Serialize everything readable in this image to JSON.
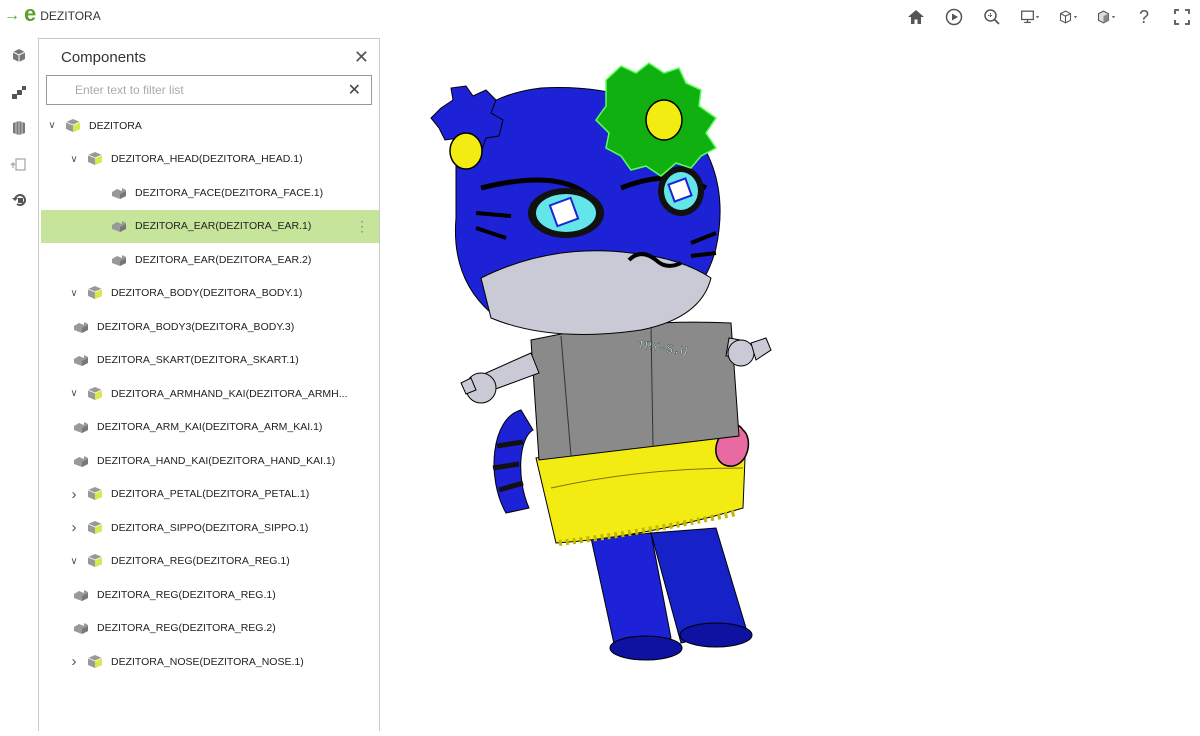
{
  "app": {
    "name": "DEZITORA"
  },
  "toolbar": {
    "icons": [
      "home-icon",
      "play-icon",
      "zoom-fit-icon",
      "display-mode-icon",
      "view-orientation-icon",
      "section-view-icon",
      "help-icon",
      "fullscreen-icon"
    ],
    "help_label": "?"
  },
  "rail": {
    "icons": [
      "components-icon",
      "steps-icon",
      "layers-icon",
      "export-icon",
      "reset-icon"
    ]
  },
  "panel": {
    "title": "Components",
    "filter_placeholder": "Enter text to filter list"
  },
  "tree": {
    "rows": [
      {
        "label": "DEZITORA",
        "level": 0,
        "expander": "expanded",
        "kind": "assembly"
      },
      {
        "label": "DEZITORA_HEAD(DEZITORA_HEAD.1)",
        "level": 1,
        "expander": "expanded",
        "kind": "assembly"
      },
      {
        "label": "DEZITORA_FACE(DEZITORA_FACE.1)",
        "level": 2,
        "expander": "none",
        "kind": "part"
      },
      {
        "label": "DEZITORA_EAR(DEZITORA_EAR.1)",
        "level": 2,
        "expander": "none",
        "kind": "part",
        "selected": true
      },
      {
        "label": "DEZITORA_EAR(DEZITORA_EAR.2)",
        "level": 2,
        "expander": "none",
        "kind": "part"
      },
      {
        "label": "DEZITORA_BODY(DEZITORA_BODY.1)",
        "level": 1,
        "expander": "expanded",
        "kind": "assembly"
      },
      {
        "label": "DEZITORA_BODY3(DEZITORA_BODY.3)",
        "level": 1,
        "expander": "none",
        "kind": "part"
      },
      {
        "label": "DEZITORA_SKART(DEZITORA_SKART.1)",
        "level": 1,
        "expander": "none",
        "kind": "part"
      },
      {
        "label": "DEZITORA_ARMHAND_KAI(DEZITORA_ARMH...",
        "level": 1,
        "expander": "expanded",
        "kind": "assembly"
      },
      {
        "label": "DEZITORA_ARM_KAI(DEZITORA_ARM_KAI.1)",
        "level": 1,
        "expander": "none",
        "kind": "part"
      },
      {
        "label": "DEZITORA_HAND_KAI(DEZITORA_HAND_KAI.1)",
        "level": 1,
        "expander": "none",
        "kind": "part"
      },
      {
        "label": "DEZITORA_PETAL(DEZITORA_PETAL.1)",
        "level": 1,
        "expander": "collapsed",
        "kind": "assembly"
      },
      {
        "label": "DEZITORA_SIPPO(DEZITORA_SIPPO.1)",
        "level": 1,
        "expander": "collapsed",
        "kind": "assembly"
      },
      {
        "label": "DEZITORA_REG(DEZITORA_REG.1)",
        "level": 1,
        "expander": "expanded",
        "kind": "assembly"
      },
      {
        "label": "DEZITORA_REG(DEZITORA_REG.1)",
        "level": 1,
        "expander": "none",
        "kind": "part"
      },
      {
        "label": "DEZITORA_REG(DEZITORA_REG.2)",
        "level": 1,
        "expander": "none",
        "kind": "part"
      },
      {
        "label": "DEZITORA_NOSE(DEZITORA_NOSE.1)",
        "level": 1,
        "expander": "collapsed",
        "kind": "assembly"
      }
    ]
  },
  "model": {
    "shirt_text": "TRY-S.U",
    "colors": {
      "blue": "#1d22d6",
      "green": "#10b010",
      "yellow": "#f2ec12",
      "gray": "#8a8a8a",
      "silver": "#c9cad6",
      "pink": "#e86aa0",
      "accent": "#c6e59a"
    }
  }
}
